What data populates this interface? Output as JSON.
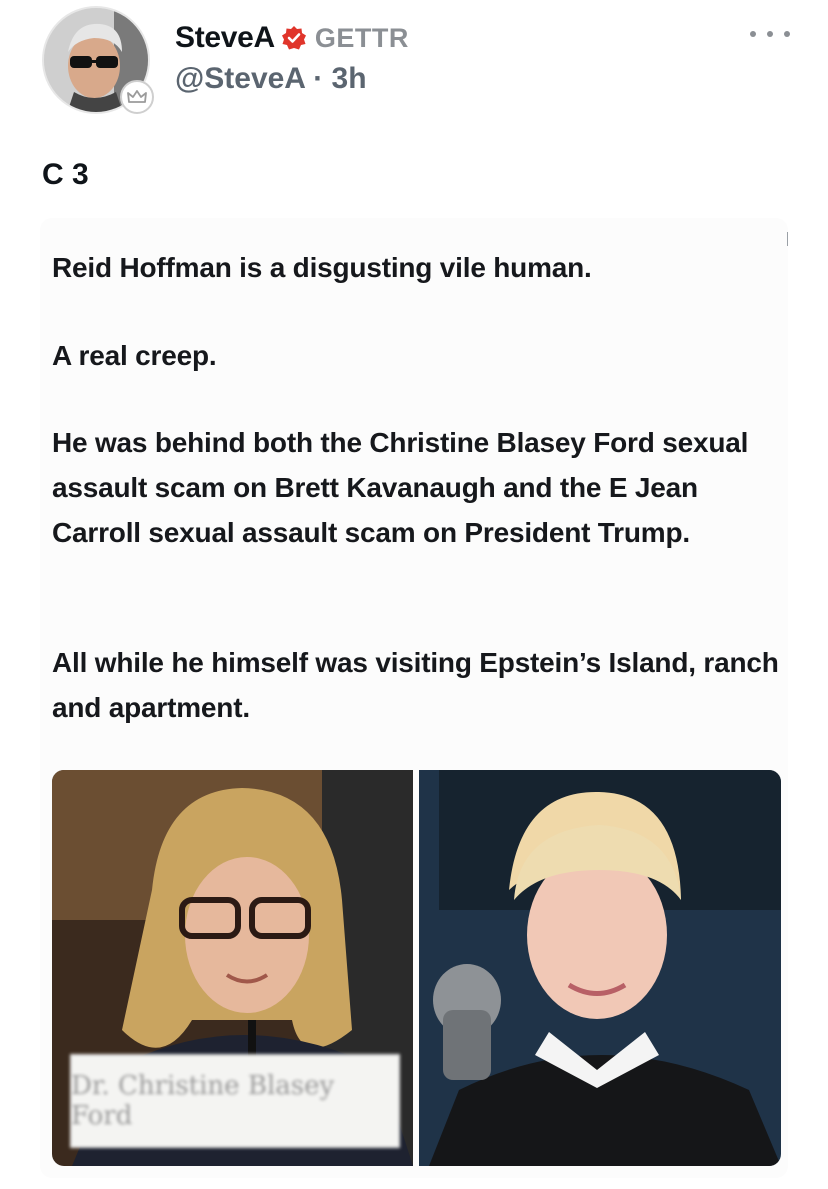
{
  "post": {
    "display_name": "SteveA",
    "platform_label": "GETTR",
    "handle": "@SteveA",
    "separator": "·",
    "time_ago": "3h",
    "text": "C 3"
  },
  "embedded": {
    "paragraphs": [
      "Reid Hoffman is a disgusting vile human.",
      "A real creep.",
      "He was behind both the Christine Blasey Ford sexual assault scam on Brett Kavanaugh and the E Jean Carroll sexual assault scam on President Trump.",
      "All while he himself was visiting Epstein’s Island, ranch and apartment."
    ],
    "nameplate_text": "Dr. Christine Blasey Ford"
  },
  "icons": {
    "verified": "verified-badge-icon",
    "more": "more-options-icon",
    "avatar_badge": "crown-badge-icon"
  },
  "colors": {
    "verified": "#e0352b",
    "muted": "#8b8f94",
    "text": "#0f1419"
  }
}
